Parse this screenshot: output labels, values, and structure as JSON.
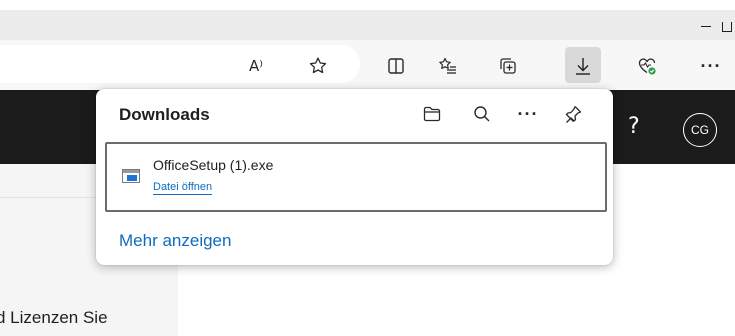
{
  "window": {
    "minimize_icon": "minimize-icon",
    "restore_icon": "restore-icon"
  },
  "toolbar": {
    "read_aloud_label": "A⁾",
    "icons": [
      "read-aloud-icon",
      "favorite-star-icon",
      "split-screen-icon",
      "favorites-list-icon",
      "collections-icon",
      "downloads-icon",
      "browser-essentials-icon",
      "more-options-icon"
    ],
    "more_label": "···"
  },
  "page_header": {
    "help_label": "?",
    "avatar_initials": "CG"
  },
  "downloads_panel": {
    "title": "Downloads",
    "more_label": "···",
    "items": [
      {
        "file_name": "OfficeSetup (1).exe",
        "action_label": "Datei öffnen"
      }
    ],
    "show_more_label": "Mehr anzeigen"
  },
  "page_content": {
    "partial_text": "d Lizenzen Sie"
  },
  "colors": {
    "link": "#0f6cbd",
    "dark_header": "#1b1b1b",
    "active_button": "#d9d9d9"
  }
}
